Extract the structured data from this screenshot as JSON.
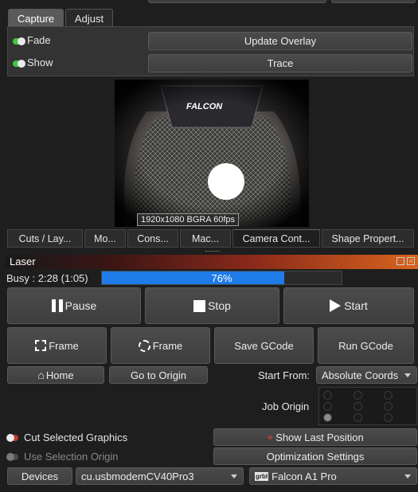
{
  "tabs": [
    "Capture",
    "Adjust"
  ],
  "capture": {
    "fade_label": "Fade",
    "show_label": "Show",
    "update_overlay_label": "Update Overlay",
    "trace_label": "Trace",
    "camera_info": "1920x1080 BGRA 60fps",
    "brand_label": "FALCON"
  },
  "dock_tabs": [
    "Cuts / Lay...",
    "Mo...",
    "Cons...",
    "Mac...",
    "Camera Cont...",
    "Shape Propert..."
  ],
  "laser": {
    "title": "Laser",
    "status": "Busy : 2:28 (1:05)",
    "progress_percent": 76,
    "progress_text": "76%",
    "pause_label": "Pause",
    "stop_label": "Stop",
    "start_label": "Start",
    "frame_label": "Frame",
    "frame_circle_label": "Frame",
    "save_gcode_label": "Save GCode",
    "run_gcode_label": "Run GCode",
    "home_label": "Home",
    "go_to_origin_label": "Go to Origin",
    "start_from_label": "Start From:",
    "start_from_value": "Absolute Coords",
    "job_origin_label": "Job Origin",
    "cut_selected_label": "Cut Selected Graphics",
    "use_selection_origin_label": "Use Selection Origin",
    "show_last_position_label": "Show Last Position",
    "optimization_settings_label": "Optimization Settings",
    "devices_label": "Devices",
    "port_value": "cu.usbmodemCV40Pro3",
    "device_value": "Falcon A1 Pro",
    "device_logo": "grbl"
  },
  "colors": {
    "accent_blue": "#1e7be8",
    "toggle_on": "#3ec83e",
    "toggle_red": "#c0392b"
  }
}
